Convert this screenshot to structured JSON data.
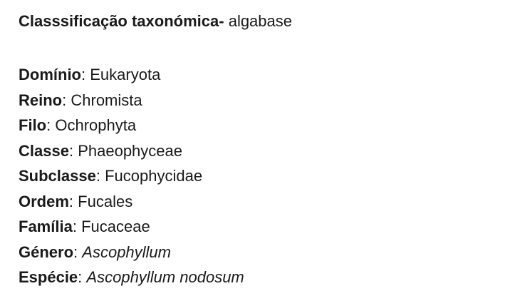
{
  "heading": {
    "title": "Classsificação taxonómica-",
    "source": "algabase"
  },
  "separator": ":",
  "ranks": [
    {
      "label": "Domínio",
      "value": "Eukaryota",
      "italic": false
    },
    {
      "label": "Reino",
      "value": "Chromista",
      "italic": false
    },
    {
      "label": "Filo",
      "value": "Ochrophyta",
      "italic": false
    },
    {
      "label": "Classe",
      "value": "Phaeophyceae",
      "italic": false
    },
    {
      "label": "Subclasse",
      "value": "Fucophycidae",
      "italic": false
    },
    {
      "label": "Ordem",
      "value": "Fucales",
      "italic": false
    },
    {
      "label": "Família",
      "value": "Fucaceae",
      "italic": false
    },
    {
      "label": "Género",
      "value": "Ascophyllum",
      "italic": true
    },
    {
      "label": "Espécie",
      "value": "Ascophyllum nodosum",
      "italic": true
    }
  ]
}
